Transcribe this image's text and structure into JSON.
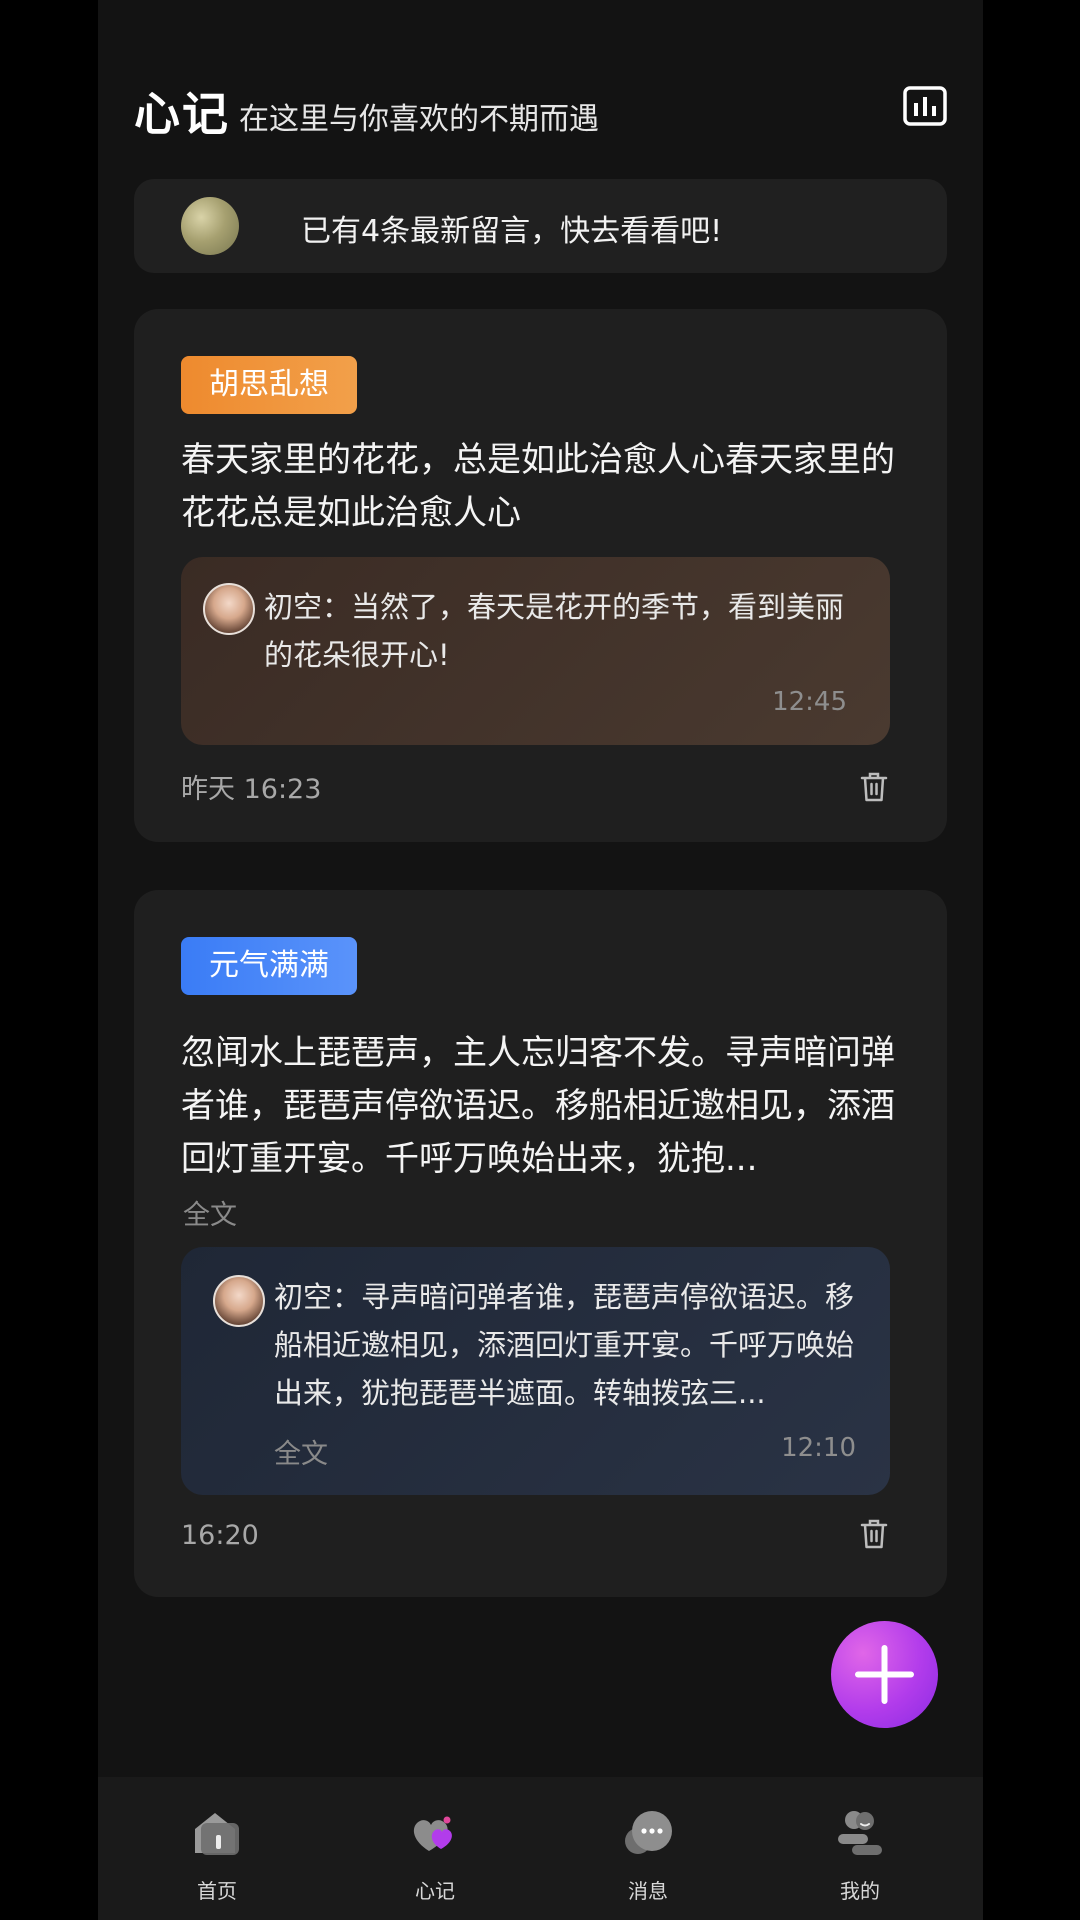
{
  "header": {
    "title": "心记",
    "subtitle": "在这里与你喜欢的不期而遇",
    "stats_icon": "bar-chart-icon"
  },
  "notice": {
    "text": "已有4条最新留言，快去看看吧!"
  },
  "cards": [
    {
      "tag": "胡思乱想",
      "tag_color": "#EE8A2E",
      "text": "春天家里的花花，总是如此治愈人心春天家里的花花总是如此治愈人心",
      "reply": {
        "text": "初空：当然了，春天是花开的季节，看到美丽的花朵很开心!",
        "time": "12:45"
      },
      "time": "昨天 16:23"
    },
    {
      "tag": "元气满满",
      "tag_color": "#3A7CF6",
      "text": "忽闻水上琵琶声，主人忘归客不发。寻声暗问弹者谁，琵琶声停欲语迟。移船相近邀相见，添酒回灯重开宴。千呼万唤始出来，犹抱...",
      "fulltext": "全文",
      "reply": {
        "text": "初空：寻声暗问弹者谁，琵琶声停欲语迟。移船相近邀相见，添酒回灯重开宴。千呼万唤始出来，犹抱琵琶半遮面。转轴拨弦三...",
        "fulltext": "全文",
        "time": "12:10"
      },
      "time": "16:20"
    }
  ],
  "fab": {
    "icon": "plus-icon",
    "color": "#B23CEB"
  },
  "nav": {
    "items": [
      {
        "label": "首页",
        "icon": "home-icon"
      },
      {
        "label": "心记",
        "icon": "heart-note-icon"
      },
      {
        "label": "消息",
        "icon": "message-icon"
      },
      {
        "label": "我的",
        "icon": "profile-icon"
      }
    ]
  }
}
